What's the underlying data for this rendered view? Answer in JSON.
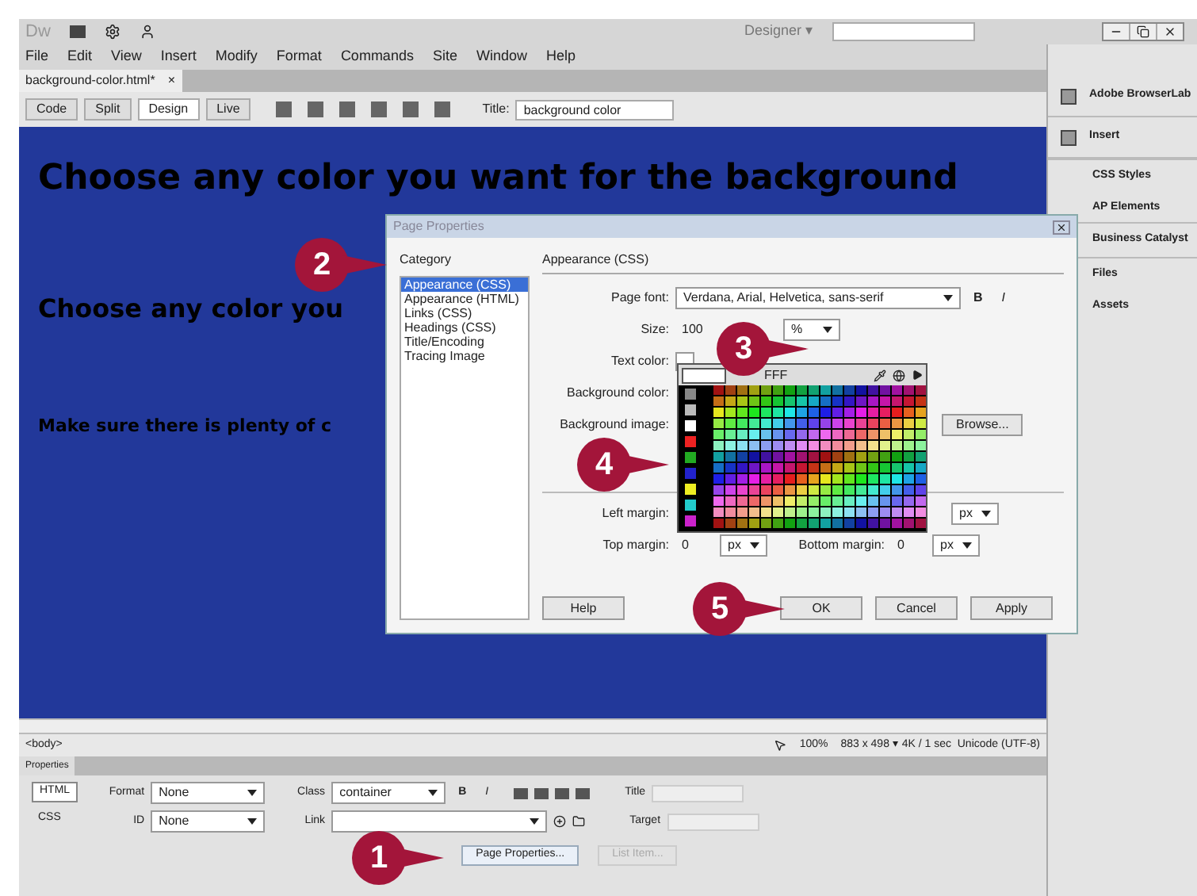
{
  "app": {
    "logo": "Dw",
    "workspace": "Designer",
    "workspace_caret": "▾"
  },
  "menu": [
    "File",
    "Edit",
    "View",
    "Insert",
    "Modify",
    "Format",
    "Commands",
    "Site",
    "Window",
    "Help"
  ],
  "document_tab": {
    "label": "background-color.html*",
    "close": "×"
  },
  "view_buttons": [
    {
      "label": "Code",
      "selected": false
    },
    {
      "label": "Split",
      "selected": false
    },
    {
      "label": "Design",
      "selected": true
    },
    {
      "label": "Live",
      "selected": false
    }
  ],
  "title_field": {
    "label": "Title:",
    "value": "background color"
  },
  "canvas": {
    "texts": [
      {
        "kind": "h1",
        "text": "Choose any color you want for the background"
      },
      {
        "kind": "h2",
        "text": "Choose any color you"
      },
      {
        "kind": "p",
        "text": "Make sure there is plenty of c"
      }
    ]
  },
  "dialog": {
    "title": "Page Properties",
    "category_label": "Category",
    "categories": [
      {
        "label": "Appearance (CSS)",
        "selected": true
      },
      {
        "label": "Appearance (HTML)",
        "selected": false
      },
      {
        "label": "Links (CSS)",
        "selected": false
      },
      {
        "label": "Headings (CSS)",
        "selected": false
      },
      {
        "label": "Title/Encoding",
        "selected": false
      },
      {
        "label": "Tracing Image",
        "selected": false
      }
    ],
    "section": "Appearance (CSS)",
    "page_font": {
      "label": "Page font:",
      "value": "Verdana, Arial, Helvetica, sans-serif",
      "bold": "B",
      "italic": "I"
    },
    "size": {
      "label": "Size:",
      "value": "100",
      "unit": "%"
    },
    "text_color_label": "Text color:",
    "picker_value": "FFF",
    "background_color_label": "Background color:",
    "background_image_label": "Background image:",
    "browse": "Browse...",
    "left_margin": {
      "label": "Left margin:",
      "unit": "px"
    },
    "top_margin": {
      "label": "Top margin:",
      "value": "0",
      "unit": "px"
    },
    "bottom_margin": {
      "label": "Bottom margin:",
      "value": "0",
      "unit": "px"
    },
    "buttons": [
      "Help",
      "OK",
      "Cancel",
      "Apply"
    ]
  },
  "status_bar": {
    "tag": "<body>",
    "zoom": "100%",
    "info": "883 x 498 ▾ 4K / 1 sec  Unicode (UTF-8)"
  },
  "properties": {
    "title": "Properties",
    "modes": [
      {
        "label": "HTML",
        "selected": true
      },
      {
        "label": "CSS",
        "selected": false
      }
    ],
    "format": {
      "label": "Format",
      "value": "None"
    },
    "id": {
      "label": "ID",
      "value": "None"
    },
    "class": {
      "label": "Class",
      "value": "container"
    },
    "link_label": "Link",
    "bold": "B",
    "italic": "I",
    "title_label": "Title",
    "target_label": "Target",
    "page_properties": "Page Properties...",
    "list_item": "List Item..."
  },
  "panels": [
    {
      "label": "Adobe BrowserLab",
      "kind": "icon"
    },
    {
      "label": "Insert",
      "kind": "icon"
    },
    {
      "label": "CSS Styles",
      "kind": "group"
    },
    {
      "label": "AP Elements",
      "kind": "item"
    },
    {
      "label": "Business Catalyst",
      "kind": "group"
    },
    {
      "label": "Files",
      "kind": "group"
    },
    {
      "label": "Assets",
      "kind": "item"
    }
  ],
  "callouts": [
    "1",
    "2",
    "3",
    "4",
    "5"
  ]
}
